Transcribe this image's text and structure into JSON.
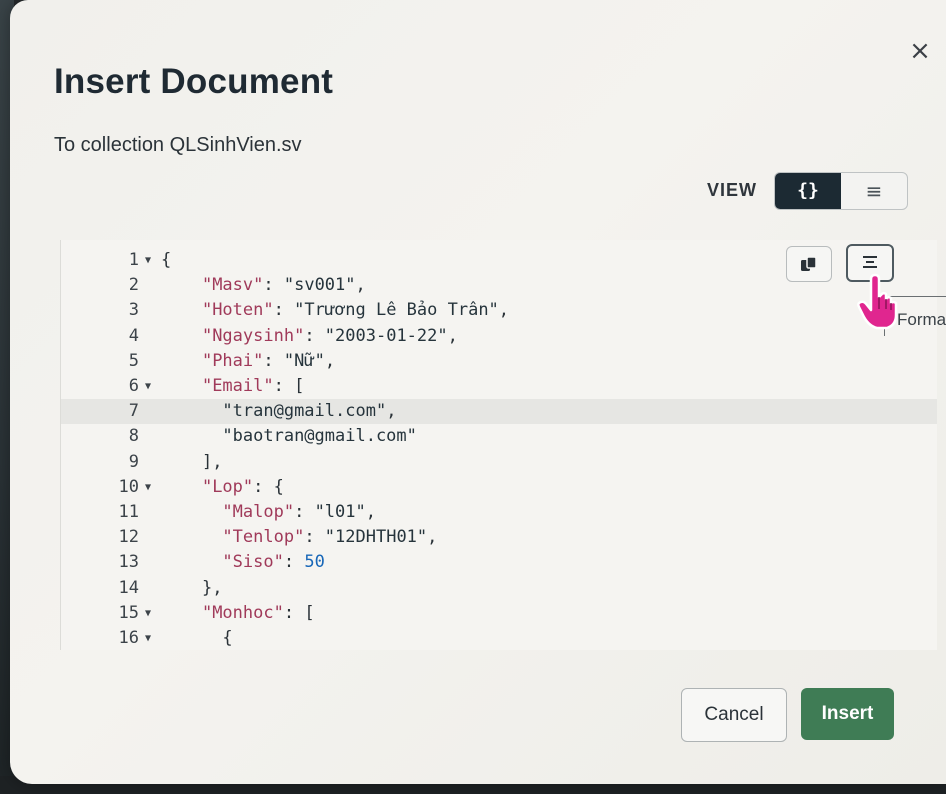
{
  "dialog": {
    "title": "Insert Document",
    "subtitle": "To collection QLSinhVien.sv",
    "close_glyph": "×"
  },
  "view": {
    "label": "VIEW",
    "json_glyph": "{}",
    "list_glyph": "≡",
    "selected": "json"
  },
  "editor": {
    "lines": [
      {
        "num": "1",
        "fold": true,
        "tokens": [
          {
            "t": "{",
            "c": "p"
          }
        ]
      },
      {
        "num": "2",
        "fold": false,
        "tokens": [
          {
            "t": "    "
          },
          {
            "t": "\"Masv\"",
            "c": "k"
          },
          {
            "t": ": ",
            "c": "p"
          },
          {
            "t": "\"sv001\"",
            "c": "s"
          },
          {
            "t": ",",
            "c": "p"
          }
        ]
      },
      {
        "num": "3",
        "fold": false,
        "tokens": [
          {
            "t": "    "
          },
          {
            "t": "\"Hoten\"",
            "c": "k"
          },
          {
            "t": ": ",
            "c": "p"
          },
          {
            "t": "\"Trương Lê Bảo Trân\"",
            "c": "s"
          },
          {
            "t": ",",
            "c": "p"
          }
        ]
      },
      {
        "num": "4",
        "fold": false,
        "tokens": [
          {
            "t": "    "
          },
          {
            "t": "\"Ngaysinh\"",
            "c": "k"
          },
          {
            "t": ": ",
            "c": "p"
          },
          {
            "t": "\"2003-01-22\"",
            "c": "s"
          },
          {
            "t": ",",
            "c": "p"
          }
        ]
      },
      {
        "num": "5",
        "fold": false,
        "tokens": [
          {
            "t": "    "
          },
          {
            "t": "\"Phai\"",
            "c": "k"
          },
          {
            "t": ": ",
            "c": "p"
          },
          {
            "t": "\"Nữ\"",
            "c": "s"
          },
          {
            "t": ",",
            "c": "p"
          }
        ]
      },
      {
        "num": "6",
        "fold": true,
        "tokens": [
          {
            "t": "    "
          },
          {
            "t": "\"Email\"",
            "c": "k"
          },
          {
            "t": ": [",
            "c": "p"
          }
        ]
      },
      {
        "num": "7",
        "fold": false,
        "active": true,
        "tokens": [
          {
            "t": "      "
          },
          {
            "t": "\"tran@gmail.com\"",
            "c": "s"
          },
          {
            "t": ",",
            "c": "p"
          }
        ]
      },
      {
        "num": "8",
        "fold": false,
        "tokens": [
          {
            "t": "      "
          },
          {
            "t": "\"baotran@gmail.com\"",
            "c": "s"
          }
        ]
      },
      {
        "num": "9",
        "fold": false,
        "tokens": [
          {
            "t": "    "
          },
          {
            "t": "],",
            "c": "p"
          }
        ]
      },
      {
        "num": "10",
        "fold": true,
        "tokens": [
          {
            "t": "    "
          },
          {
            "t": "\"Lop\"",
            "c": "k"
          },
          {
            "t": ": {",
            "c": "p"
          }
        ]
      },
      {
        "num": "11",
        "fold": false,
        "tokens": [
          {
            "t": "      "
          },
          {
            "t": "\"Malop\"",
            "c": "k"
          },
          {
            "t": ": ",
            "c": "p"
          },
          {
            "t": "\"l01\"",
            "c": "s"
          },
          {
            "t": ",",
            "c": "p"
          }
        ]
      },
      {
        "num": "12",
        "fold": false,
        "tokens": [
          {
            "t": "      "
          },
          {
            "t": "\"Tenlop\"",
            "c": "k"
          },
          {
            "t": ": ",
            "c": "p"
          },
          {
            "t": "\"12DHTH01\"",
            "c": "s"
          },
          {
            "t": ",",
            "c": "p"
          }
        ]
      },
      {
        "num": "13",
        "fold": false,
        "tokens": [
          {
            "t": "      "
          },
          {
            "t": "\"Siso\"",
            "c": "k"
          },
          {
            "t": ": ",
            "c": "p"
          },
          {
            "t": "50",
            "c": "n"
          }
        ]
      },
      {
        "num": "14",
        "fold": false,
        "tokens": [
          {
            "t": "    "
          },
          {
            "t": "},",
            "c": "p"
          }
        ]
      },
      {
        "num": "15",
        "fold": true,
        "tokens": [
          {
            "t": "    "
          },
          {
            "t": "\"Monhoc\"",
            "c": "k"
          },
          {
            "t": ": [",
            "c": "p"
          }
        ]
      },
      {
        "num": "16",
        "fold": true,
        "tokens": [
          {
            "t": "      "
          },
          {
            "t": "{",
            "c": "p"
          }
        ]
      }
    ],
    "copy_icon": "copy-icon",
    "format_icon": "format-icon",
    "tooltip": "Forma"
  },
  "actions": {
    "cancel_label": "Cancel",
    "insert_label": "Insert"
  },
  "colors": {
    "insert_bg": "#3f7c55",
    "toggle_active_bg": "#1c2a33",
    "cursor_pink": "#e0268f"
  }
}
